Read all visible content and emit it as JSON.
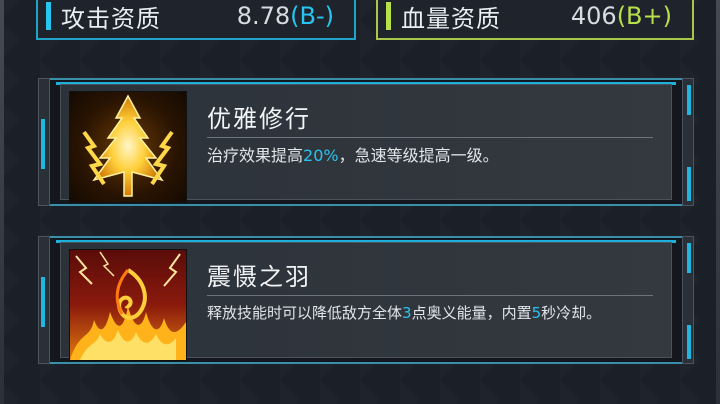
{
  "stats": {
    "attack": {
      "label": "攻击资质",
      "value": "8.78",
      "grade": "(B-)"
    },
    "hp": {
      "label": "血量资质",
      "value": "406",
      "grade": "(B+)"
    }
  },
  "skills": [
    {
      "icon": "lightning-tree-icon",
      "title": "优雅修行",
      "desc_before": "治疗效果提高",
      "desc_highlight": "20%",
      "desc_after": "，急速等级提高一级。"
    },
    {
      "icon": "fire-feather-icon",
      "title": "震慑之羽",
      "desc_part1": "释放技能时可以降低敌方全体",
      "desc_hl1": "3",
      "desc_part2": "点奥义能量，内置",
      "desc_hl2": "5",
      "desc_part3": "秒冷却。"
    }
  ],
  "colors": {
    "accent_cyan": "#27c6f0",
    "accent_green": "#b8e04a"
  }
}
